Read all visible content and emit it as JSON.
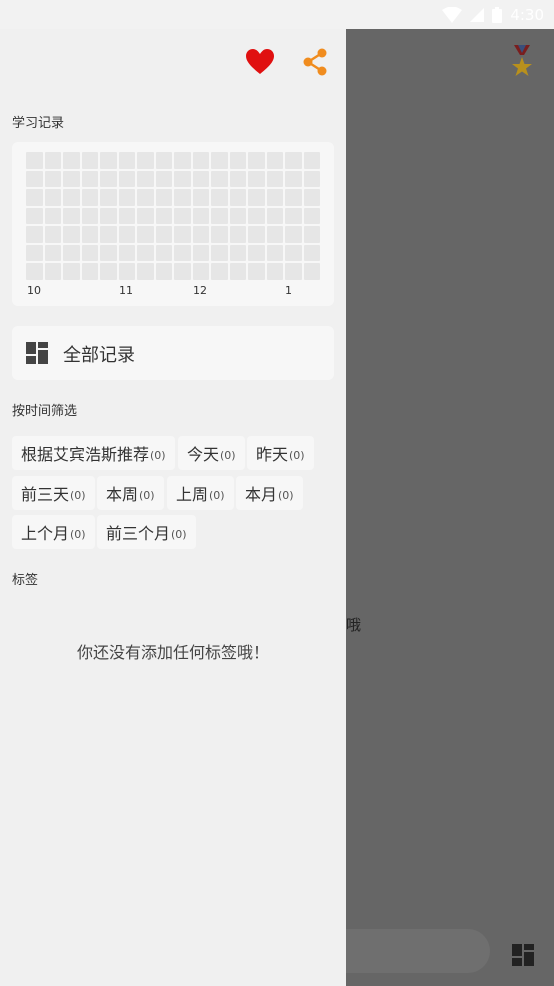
{
  "status_bar": {
    "time": "4:30"
  },
  "background_app": {
    "empty_text_fragment": "哦"
  },
  "drawer": {
    "study_record_label": "学习记录",
    "heatmap": {
      "rows": 7,
      "cols": 16,
      "months": [
        {
          "label": "10"
        },
        {
          "label": "11"
        },
        {
          "label": "12"
        },
        {
          "label": "1"
        }
      ]
    },
    "all_records_label": "全部记录",
    "filter_label": "按时间筛选",
    "filters": [
      {
        "label": "根据艾宾浩斯推荐",
        "count": "(0)"
      },
      {
        "label": "今天",
        "count": "(0)"
      },
      {
        "label": "昨天",
        "count": "(0)"
      },
      {
        "label": "前三天",
        "count": "(0)"
      },
      {
        "label": "本周",
        "count": "(0)"
      },
      {
        "label": "上周",
        "count": "(0)"
      },
      {
        "label": "本月",
        "count": "(0)"
      },
      {
        "label": "上个月",
        "count": "(0)"
      },
      {
        "label": "前三个月",
        "count": "(0)"
      }
    ],
    "tags_label": "标签",
    "no_tags_text": "你还没有添加任何标签哦！"
  },
  "colors": {
    "heart": "#e01010",
    "share": "#f08c1e",
    "drawer_bg": "#f0f0f0",
    "card_bg": "#f7f7f7"
  }
}
